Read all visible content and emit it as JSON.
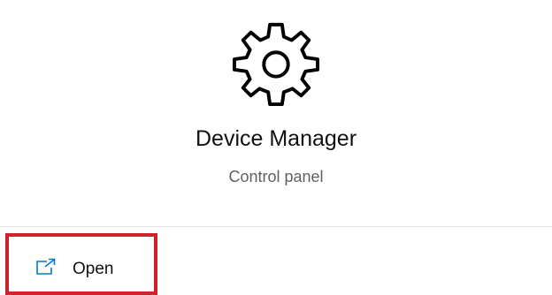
{
  "app": {
    "name": "Device Manager",
    "type": "Control panel",
    "icon": "gear-icon"
  },
  "actions": {
    "open_label": "Open",
    "open_icon": "open-external-icon",
    "highlight_color": "#d2222d"
  },
  "colors": {
    "accent": "#0078d4"
  }
}
